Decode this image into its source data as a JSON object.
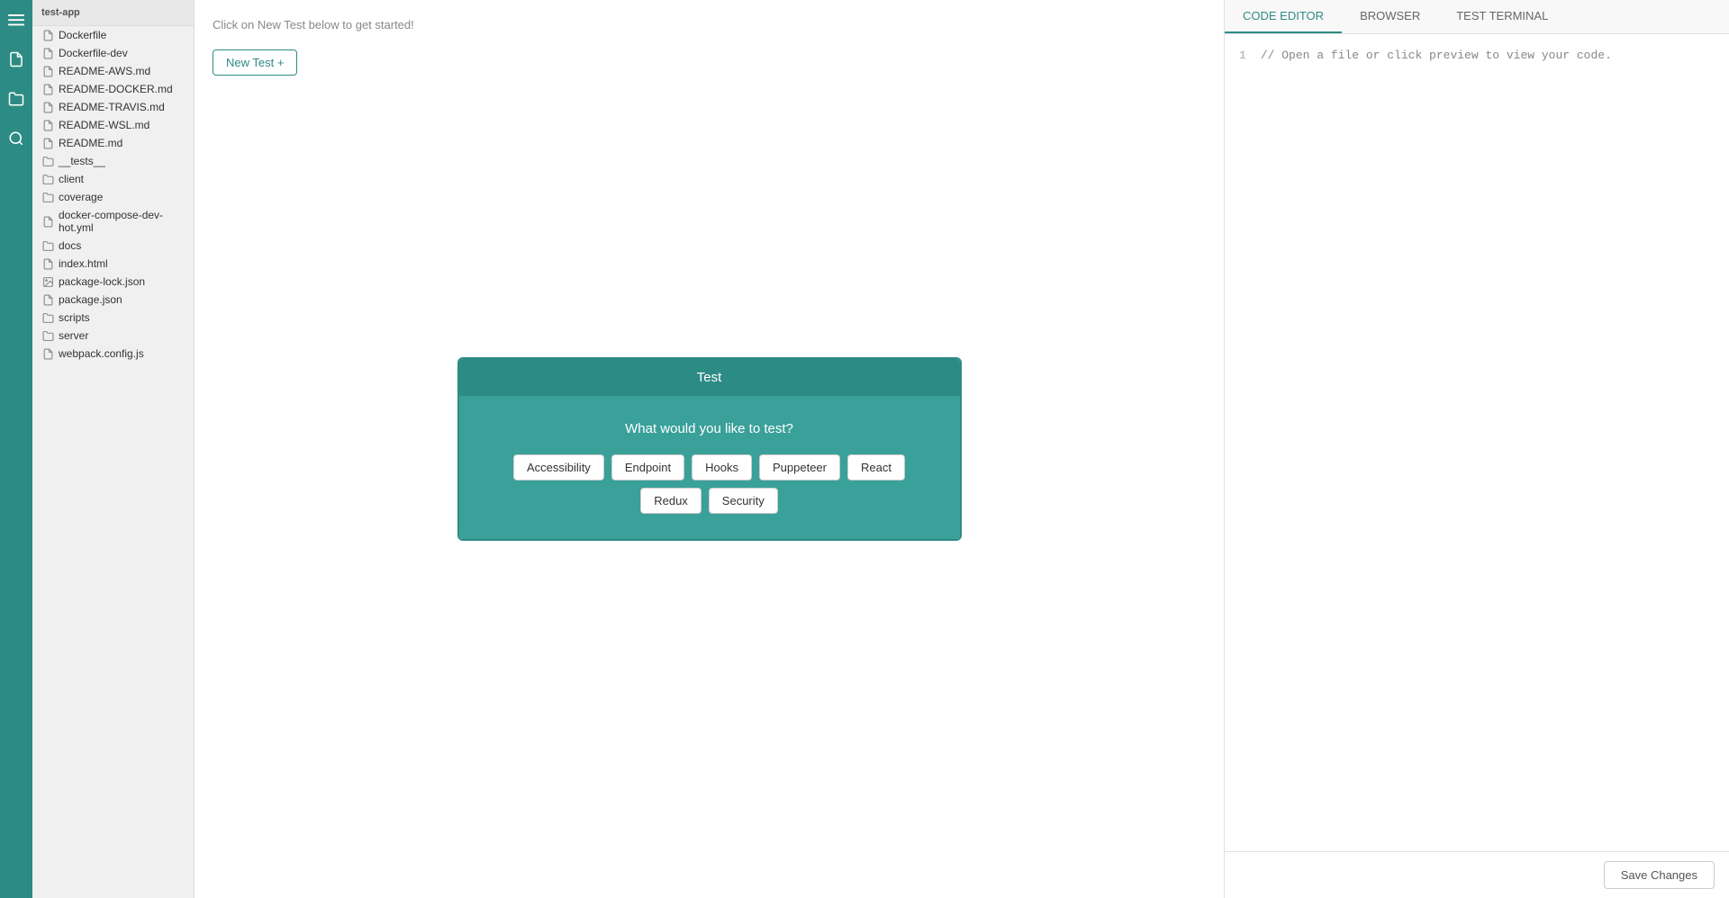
{
  "app": {
    "title": "test-app"
  },
  "icon_sidebar": {
    "icons": [
      {
        "name": "menu-icon",
        "symbol": "≡"
      },
      {
        "name": "file-icon",
        "symbol": "📄"
      },
      {
        "name": "folder-open-icon",
        "symbol": "📁"
      },
      {
        "name": "search-icon",
        "symbol": "🔍"
      }
    ]
  },
  "file_tree": {
    "header": "test-app",
    "items": [
      {
        "label": "Dockerfile",
        "type": "doc"
      },
      {
        "label": "Dockerfile-dev",
        "type": "doc"
      },
      {
        "label": "README-AWS.md",
        "type": "doc"
      },
      {
        "label": "README-DOCKER.md",
        "type": "doc"
      },
      {
        "label": "README-TRAVIS.md",
        "type": "doc"
      },
      {
        "label": "README-WSL.md",
        "type": "doc"
      },
      {
        "label": "README.md",
        "type": "doc"
      },
      {
        "label": "__tests__",
        "type": "folder"
      },
      {
        "label": "client",
        "type": "folder"
      },
      {
        "label": "coverage",
        "type": "folder"
      },
      {
        "label": "docker-compose-dev-hot.yml",
        "type": "doc"
      },
      {
        "label": "docs",
        "type": "folder"
      },
      {
        "label": "index.html",
        "type": "doc"
      },
      {
        "label": "package-lock.json",
        "type": "img"
      },
      {
        "label": "package.json",
        "type": "doc"
      },
      {
        "label": "scripts",
        "type": "folder"
      },
      {
        "label": "server",
        "type": "folder"
      },
      {
        "label": "webpack.config.js",
        "type": "doc"
      }
    ]
  },
  "test_panel": {
    "hint": "Click on New Test below to get started!",
    "new_test_button": "New Test +"
  },
  "modal": {
    "title": "Test",
    "question": "What would you like to test?",
    "options": [
      {
        "label": "Accessibility"
      },
      {
        "label": "Endpoint"
      },
      {
        "label": "Hooks"
      },
      {
        "label": "Puppeteer"
      },
      {
        "label": "React"
      },
      {
        "label": "Redux"
      },
      {
        "label": "Security"
      }
    ]
  },
  "editor_panel": {
    "tabs": [
      {
        "label": "CODE EDITOR",
        "active": true
      },
      {
        "label": "BROWSER",
        "active": false
      },
      {
        "label": "TEST TERMINAL",
        "active": false
      }
    ],
    "placeholder_comment": "// Open a file or click preview to view your code.",
    "line_number": "1",
    "save_button": "Save Changes"
  }
}
